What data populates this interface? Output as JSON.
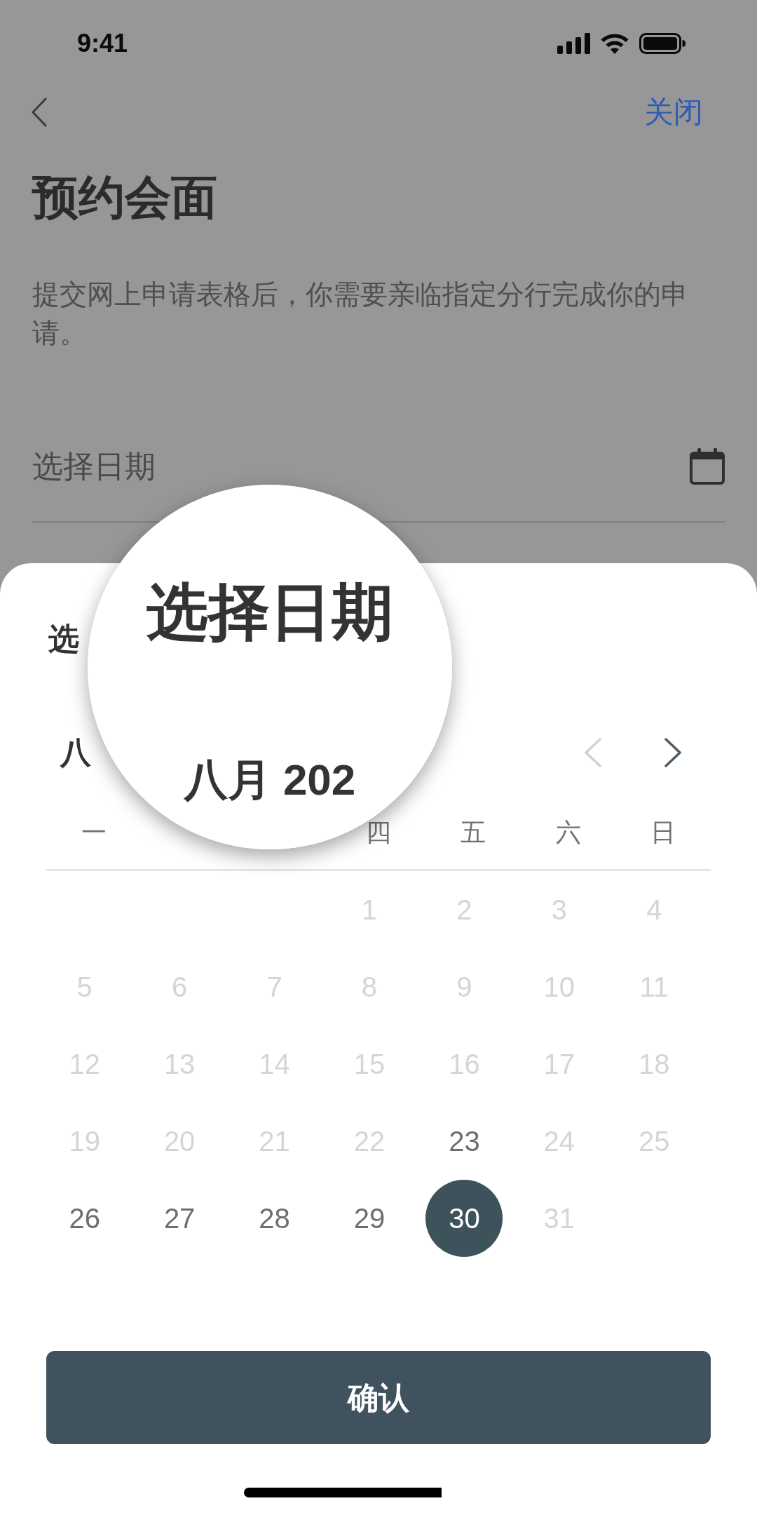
{
  "status_bar": {
    "time": "9:41"
  },
  "nav": {
    "close_label": "关闭"
  },
  "page": {
    "title": "预约会面",
    "description": "提交网上申请表格后，你需要亲临指定分行完成你的申请。",
    "date_field": {
      "placeholder": "选择日期"
    }
  },
  "sheet": {
    "title": "选",
    "month": "八",
    "prev_button": {
      "disabled": true
    },
    "next_button": {
      "disabled": false
    },
    "weekdays": [
      "一",
      "四",
      "五",
      "六",
      "日"
    ],
    "weeks": [
      [
        {
          "day": "1",
          "disabled": true,
          "selected": false
        },
        {
          "day": "2",
          "disabled": true,
          "selected": false
        },
        {
          "day": "3",
          "disabled": true,
          "selected": false
        },
        {
          "day": "4",
          "disabled": true,
          "selected": false
        }
      ],
      [
        {
          "day": "5",
          "disabled": true,
          "selected": false
        },
        {
          "day": "6",
          "disabled": true,
          "selected": false
        },
        {
          "day": "7",
          "disabled": true,
          "selected": false
        },
        {
          "day": "8",
          "disabled": true,
          "selected": false
        },
        {
          "day": "9",
          "disabled": true,
          "selected": false
        },
        {
          "day": "10",
          "disabled": true,
          "selected": false
        },
        {
          "day": "11",
          "disabled": true,
          "selected": false
        }
      ],
      [
        {
          "day": "12",
          "disabled": true,
          "selected": false
        },
        {
          "day": "13",
          "disabled": true,
          "selected": false
        },
        {
          "day": "14",
          "disabled": true,
          "selected": false
        },
        {
          "day": "15",
          "disabled": true,
          "selected": false
        },
        {
          "day": "16",
          "disabled": true,
          "selected": false
        },
        {
          "day": "17",
          "disabled": true,
          "selected": false
        },
        {
          "day": "18",
          "disabled": true,
          "selected": false
        }
      ],
      [
        {
          "day": "19",
          "disabled": true,
          "selected": false
        },
        {
          "day": "20",
          "disabled": true,
          "selected": false
        },
        {
          "day": "21",
          "disabled": true,
          "selected": false
        },
        {
          "day": "22",
          "disabled": true,
          "selected": false
        },
        {
          "day": "23",
          "disabled": false,
          "selected": false
        },
        {
          "day": "24",
          "disabled": true,
          "selected": false
        },
        {
          "day": "25",
          "disabled": true,
          "selected": false
        }
      ],
      [
        {
          "day": "26",
          "disabled": false,
          "selected": false
        },
        {
          "day": "27",
          "disabled": false,
          "selected": false
        },
        {
          "day": "28",
          "disabled": false,
          "selected": false
        },
        {
          "day": "29",
          "disabled": false,
          "selected": false
        },
        {
          "day": "30",
          "disabled": false,
          "selected": true
        },
        {
          "day": "31",
          "disabled": true,
          "selected": false
        }
      ]
    ],
    "confirm_button": "确认"
  },
  "magnifier": {
    "title": "选择日期",
    "month": "八月 202"
  }
}
